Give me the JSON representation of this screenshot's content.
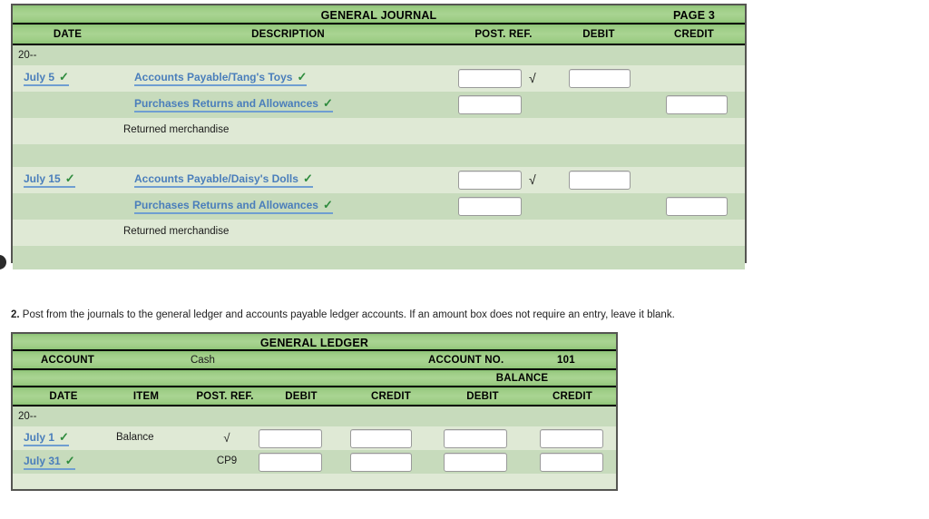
{
  "journal": {
    "title": "GENERAL JOURNAL",
    "page_label": "PAGE 3",
    "columns": [
      "DATE",
      "DESCRIPTION",
      "POST. REF.",
      "DEBIT",
      "CREDIT"
    ],
    "year_label": "20--",
    "rows": [
      {
        "date": "July 5",
        "date_check": "✓",
        "description": "Accounts Payable/Tang's Toys",
        "desc_check": "✓",
        "desc_indent": 0,
        "post_ref_box": true,
        "post_ref_tick": "√",
        "debit_box": true,
        "credit_box": false
      },
      {
        "date": "",
        "description": "Purchases Returns and Allowances",
        "desc_check": "✓",
        "desc_indent": 1,
        "post_ref_box": true,
        "post_ref_tick": "",
        "debit_box": false,
        "credit_box": true
      },
      {
        "date": "",
        "description": "Returned merchandise",
        "plain": true,
        "desc_indent": 1,
        "post_ref_box": false,
        "debit_box": false,
        "credit_box": false
      },
      {
        "date": "",
        "description": "",
        "spacer": true,
        "post_ref_box": false,
        "debit_box": false,
        "credit_box": false
      },
      {
        "date": "July 15",
        "date_check": "✓",
        "description": "Accounts Payable/Daisy's Dolls",
        "desc_check": "✓",
        "desc_indent": 0,
        "post_ref_box": true,
        "post_ref_tick": "√",
        "debit_box": true,
        "credit_box": false
      },
      {
        "date": "",
        "description": "Purchases Returns and Allowances",
        "desc_check": "✓",
        "desc_indent": 1,
        "post_ref_box": true,
        "post_ref_tick": "",
        "debit_box": false,
        "credit_box": true
      },
      {
        "date": "",
        "description": "Returned merchandise",
        "plain": true,
        "desc_indent": 1,
        "post_ref_box": false,
        "debit_box": false,
        "credit_box": false
      },
      {
        "date": "",
        "description": "",
        "spacer": true,
        "post_ref_box": false,
        "debit_box": false,
        "credit_box": false
      }
    ]
  },
  "instruction": {
    "number": "2.",
    "text": "Post from the journals to the general ledger and accounts payable ledger accounts. If an amount box does not require an entry, leave it blank."
  },
  "ledger": {
    "title": "GENERAL LEDGER",
    "account_label": "ACCOUNT",
    "account_name": "Cash",
    "account_no_label": "ACCOUNT NO.",
    "account_no": "101",
    "balance_label": "BALANCE",
    "columns": [
      "DATE",
      "ITEM",
      "POST. REF.",
      "DEBIT",
      "CREDIT",
      "DEBIT",
      "CREDIT"
    ],
    "year_label": "20--",
    "rows": [
      {
        "date": "July 1",
        "date_check": "✓",
        "item": "Balance",
        "post_ref": "√",
        "boxes": 4
      },
      {
        "date": "July 31",
        "date_check": "✓",
        "item": "",
        "post_ref": "CP9",
        "boxes": 4
      }
    ]
  },
  "colors": {
    "header_green": "#9ecd86",
    "row_dark": "#c7dbbc",
    "row_light": "#dfe9d5",
    "link_blue": "#4a7ebb",
    "check_green": "#2e8b3d",
    "border": "#555552"
  }
}
